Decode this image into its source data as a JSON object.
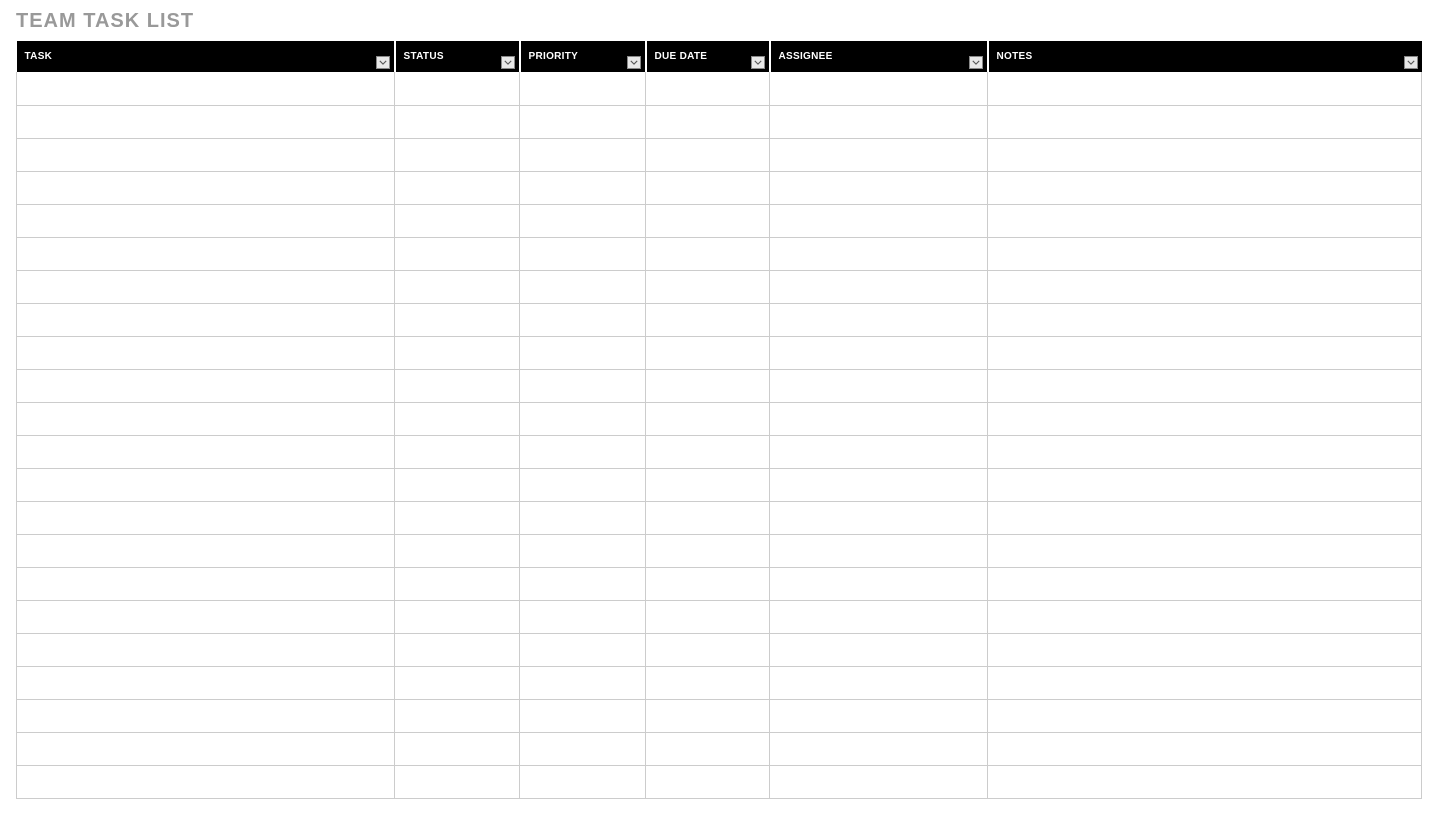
{
  "title": "TEAM TASK LIST",
  "columns": [
    {
      "label": "TASK"
    },
    {
      "label": "STATUS"
    },
    {
      "label": "PRIORITY"
    },
    {
      "label": "DUE DATE"
    },
    {
      "label": "ASSIGNEE"
    },
    {
      "label": "NOTES"
    }
  ],
  "rows": [
    {
      "task": "",
      "status": "",
      "priority": "",
      "due_date": "",
      "assignee": "",
      "notes": ""
    },
    {
      "task": "",
      "status": "",
      "priority": "",
      "due_date": "",
      "assignee": "",
      "notes": ""
    },
    {
      "task": "",
      "status": "",
      "priority": "",
      "due_date": "",
      "assignee": "",
      "notes": ""
    },
    {
      "task": "",
      "status": "",
      "priority": "",
      "due_date": "",
      "assignee": "",
      "notes": ""
    },
    {
      "task": "",
      "status": "",
      "priority": "",
      "due_date": "",
      "assignee": "",
      "notes": ""
    },
    {
      "task": "",
      "status": "",
      "priority": "",
      "due_date": "",
      "assignee": "",
      "notes": ""
    },
    {
      "task": "",
      "status": "",
      "priority": "",
      "due_date": "",
      "assignee": "",
      "notes": ""
    },
    {
      "task": "",
      "status": "",
      "priority": "",
      "due_date": "",
      "assignee": "",
      "notes": ""
    },
    {
      "task": "",
      "status": "",
      "priority": "",
      "due_date": "",
      "assignee": "",
      "notes": ""
    },
    {
      "task": "",
      "status": "",
      "priority": "",
      "due_date": "",
      "assignee": "",
      "notes": ""
    },
    {
      "task": "",
      "status": "",
      "priority": "",
      "due_date": "",
      "assignee": "",
      "notes": ""
    },
    {
      "task": "",
      "status": "",
      "priority": "",
      "due_date": "",
      "assignee": "",
      "notes": ""
    },
    {
      "task": "",
      "status": "",
      "priority": "",
      "due_date": "",
      "assignee": "",
      "notes": ""
    },
    {
      "task": "",
      "status": "",
      "priority": "",
      "due_date": "",
      "assignee": "",
      "notes": ""
    },
    {
      "task": "",
      "status": "",
      "priority": "",
      "due_date": "",
      "assignee": "",
      "notes": ""
    },
    {
      "task": "",
      "status": "",
      "priority": "",
      "due_date": "",
      "assignee": "",
      "notes": ""
    },
    {
      "task": "",
      "status": "",
      "priority": "",
      "due_date": "",
      "assignee": "",
      "notes": ""
    },
    {
      "task": "",
      "status": "",
      "priority": "",
      "due_date": "",
      "assignee": "",
      "notes": ""
    },
    {
      "task": "",
      "status": "",
      "priority": "",
      "due_date": "",
      "assignee": "",
      "notes": ""
    },
    {
      "task": "",
      "status": "",
      "priority": "",
      "due_date": "",
      "assignee": "",
      "notes": ""
    },
    {
      "task": "",
      "status": "",
      "priority": "",
      "due_date": "",
      "assignee": "",
      "notes": ""
    },
    {
      "task": "",
      "status": "",
      "priority": "",
      "due_date": "",
      "assignee": "",
      "notes": ""
    }
  ]
}
